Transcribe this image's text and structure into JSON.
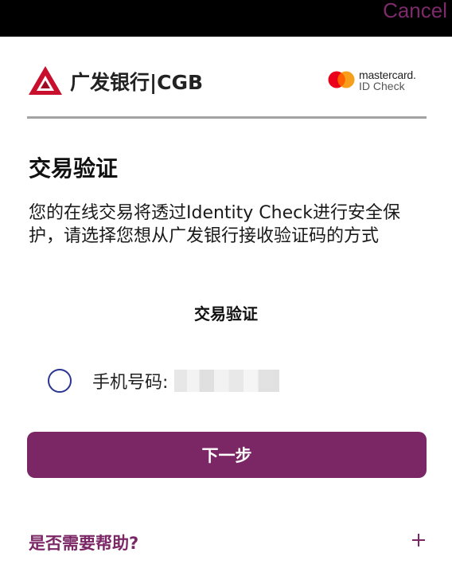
{
  "header": {
    "cancel_label": "Cancel"
  },
  "bank": {
    "name": "广发银行|CGB"
  },
  "mastercard": {
    "brand": "mastercard.",
    "sub": "ID Check"
  },
  "main": {
    "title": "交易验证",
    "description": "您的在线交易将透过Identity Check进行安全保护，请选择您想从广发银行接收验证码的方式",
    "section_title": "交易验证",
    "option_label": "手机号码:",
    "next_button": "下一步",
    "help_label": "是否需要帮助?"
  },
  "colors": {
    "accent": "#7b2766",
    "radio_border": "#2a3591",
    "bank_logo": "#c8102e"
  },
  "icons": {
    "bank_logo": "cgb-logo-icon",
    "mastercard_logo": "mastercard-logo-icon",
    "expand": "plus-icon"
  }
}
